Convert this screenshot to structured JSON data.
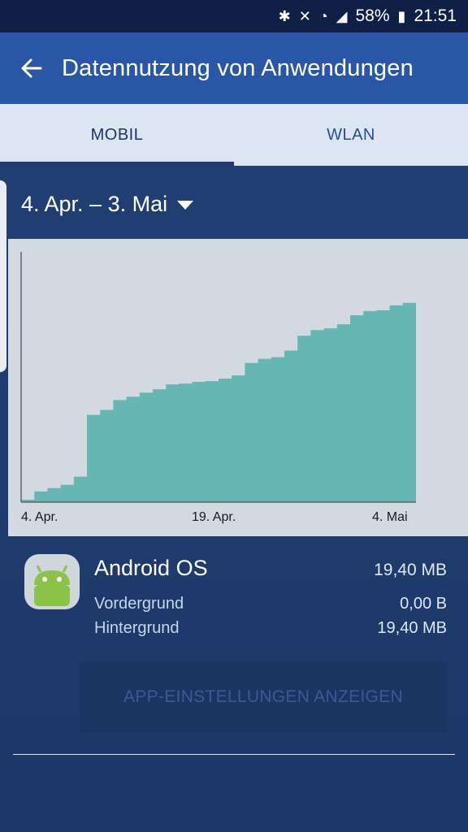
{
  "status_bar": {
    "battery": "58%",
    "time": "21:51",
    "icons": [
      "bluetooth-icon",
      "mute-icon",
      "wifi-icon",
      "signal-icon",
      "battery-icon"
    ]
  },
  "app_bar": {
    "title": "Datennutzung von Anwendungen",
    "back_icon": "arrow-left-icon"
  },
  "tabs": [
    {
      "label": "MOBIL",
      "active": true
    },
    {
      "label": "WLAN",
      "active": false
    }
  ],
  "date_range": {
    "label": "4. Apr. – 3. Mai"
  },
  "chart_data": {
    "type": "area",
    "x_tick_labels": [
      "4. Apr.",
      "19. Apr.",
      "4. Mai"
    ],
    "x": [
      0,
      1,
      2,
      3,
      4,
      5,
      6,
      7,
      8,
      9,
      10,
      11,
      12,
      13,
      14,
      15,
      16,
      17,
      18,
      19,
      20,
      21,
      22,
      23,
      24,
      25,
      26,
      27,
      28,
      29,
      30
    ],
    "series": [
      {
        "values": [
          0.3,
          1.3,
          1.7,
          2.1,
          3.1,
          10.6,
          11.2,
          12.4,
          12.8,
          13.3,
          13.7,
          14.3,
          14.4,
          14.6,
          14.7,
          15.0,
          15.4,
          16.9,
          17.4,
          17.6,
          18.4,
          20.2,
          20.9,
          21.1,
          21.6,
          22.7,
          23.2,
          23.3,
          23.9,
          24.2,
          24.5
        ]
      }
    ],
    "ylim": [
      0,
      30
    ],
    "grid": false,
    "fill_color": "#66b7b3",
    "axis_color": "#666666"
  },
  "app_usage": {
    "name": "Android OS",
    "icon": "android-icon",
    "total": "19,40 MB",
    "foreground_label": "Vordergrund",
    "foreground_value": "0,00 B",
    "background_label": "Hintergrund",
    "background_value": "19,40 MB"
  },
  "settings_button": {
    "label": "APP-EINSTELLUNGEN ANZEIGEN"
  },
  "colors": {
    "app_bar": "#2a56a8",
    "status_bar": "#0f1f45",
    "background": "#1e3a6e",
    "chart_fill": "#66b7b3"
  }
}
